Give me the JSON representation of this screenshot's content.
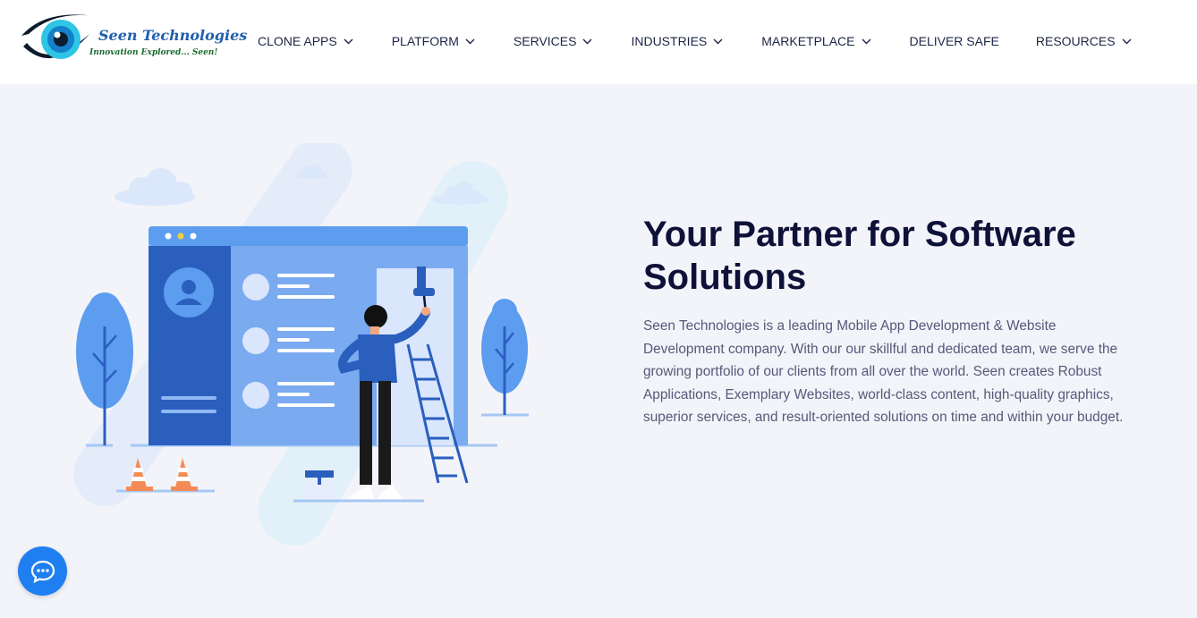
{
  "brand": {
    "name": "Seen Technologies",
    "tagline": "Innovation Explored... Seen!",
    "logo_icon": "eye-logo-icon",
    "colors": {
      "primary": "#1f7ff0",
      "navy": "#0e1138",
      "logo_blue": "#1f5fae",
      "logo_green": "#1a6b30"
    }
  },
  "nav": {
    "items": [
      {
        "label": "CLONE APPS",
        "has_dropdown": true
      },
      {
        "label": "PLATFORM",
        "has_dropdown": true
      },
      {
        "label": "SERVICES",
        "has_dropdown": true
      },
      {
        "label": "INDUSTRIES",
        "has_dropdown": true
      },
      {
        "label": "MARKETPLACE",
        "has_dropdown": true
      },
      {
        "label": "DELIVER SAFE",
        "has_dropdown": false
      },
      {
        "label": "RESOURCES",
        "has_dropdown": true
      }
    ]
  },
  "hero": {
    "title": "Your Partner for Software Solutions",
    "description": "Seen Technologies is a leading Mobile App Development & Website Development company. With our our skillful and dedicated team, we serve the growing portfolio of our clients from all over the world. Seen creates Robust Applications, Exemplary Websites, world-class content, high-quality graphics, superior services, and result-oriented solutions on time and within your budget.",
    "illustration": "web-development-painter-illustration"
  },
  "chat": {
    "icon": "chat-bubble-icon"
  }
}
